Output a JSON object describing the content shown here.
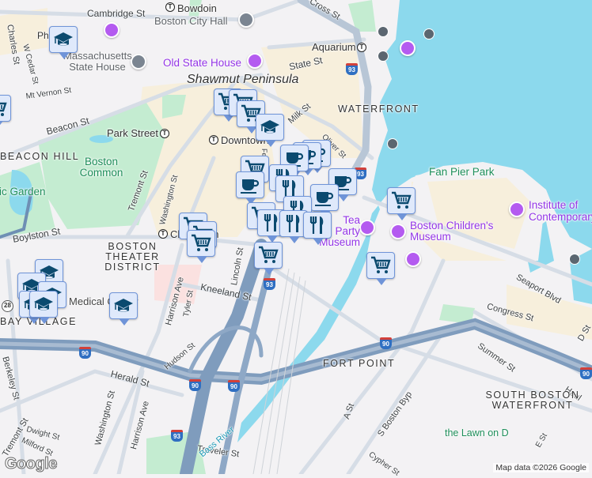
{
  "map": {
    "colors": {
      "water": "#8cd9ed",
      "park": "#c4ecd1",
      "land": "#f3f2f4",
      "commercial": "#f7efdc",
      "highway": "#7f9cbd",
      "road": "#d6dde6",
      "marker_fill": "#dfe9fb",
      "marker_icon": "#0b4a6f",
      "poi_purple": "#9334e6"
    },
    "streets": {
      "cambridge": "Cambridge St",
      "charles": "Charles St",
      "wcedar": "W Cedar St",
      "mtvernon": "Mt Vernon St",
      "beacon": "Beacon St",
      "state": "State St",
      "milk": "Milk St",
      "oliver": "Oliver St",
      "tremont": "Tremont St",
      "washington1": "Washington St",
      "boylston": "Boylston St",
      "lincoln": "Lincoln St",
      "kneeland": "Kneeland St",
      "harrison1": "Harrison Ave",
      "tyler": "Tyler St",
      "hudson": "Hudson St",
      "herald": "Herald St",
      "washington2": "Washington St",
      "harrison2": "Harrison Ave",
      "berkeley": "Berkeley St",
      "dwight": "Dwight St",
      "milford": "Milford St",
      "tremont2": "Tremont St",
      "traveler": "Traveler St",
      "congress": "Congress St",
      "seaport": "Seaport Blvd",
      "summer": "Summer St",
      "a_st": "A St",
      "sboston": "S Boston Byp",
      "d_st": "D St",
      "e_st": "E St",
      "cypher": "Cypher St",
      "cross": "Cross St",
      "haul": "Haul",
      "federal": "Fe"
    },
    "districts": {
      "shawmut": "Shawmut Peninsula",
      "beacon_hill": "BEACON HILL",
      "theater": "BOSTON THEATER DISTRICT",
      "bay_village": "BAY VILLAGE",
      "waterfront": "WATERFRONT",
      "fort_point": "FORT POINT",
      "sb_waterfront": "SOUTH BOSTON WATERFRONT"
    },
    "places": {
      "bowdoin": "Bowdoin",
      "city_hall": "Boston City Hall",
      "state_house": "Massachusetts State House",
      "old_state_house": "Old State House",
      "park_street": "Park Street",
      "downtown": "Downtown",
      "aquarium": "Aquarium",
      "common": "Boston Common",
      "public_garden": "Public Garden",
      "fan_pier": "Fan Pier Park",
      "ica": "Institute of Contemporary",
      "childrens": "Boston Children's Museum",
      "tea_party": "Tea Party Museum",
      "tufts": "Tufts Medical Center",
      "bass_river": "Bass River",
      "lawn_on_d": "the Lawn on D",
      "chinatown": "Chinatown",
      "ph": "Ph"
    },
    "highways": {
      "i93": "93",
      "i90": "90",
      "rt28": "28"
    },
    "transit_symbol": "T",
    "marker_types": [
      "shopping-cart",
      "graduation-cap",
      "coffee-cup",
      "cutlery"
    ],
    "attribution": "Map data ©2026 Google",
    "logo": "Google"
  }
}
